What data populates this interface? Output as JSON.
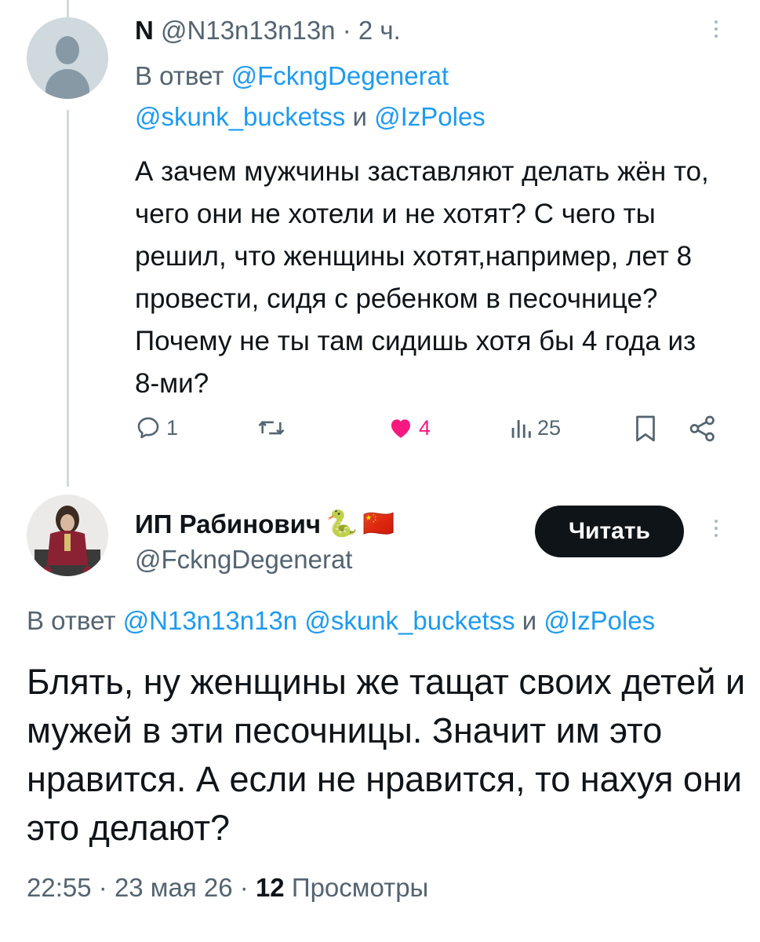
{
  "tweet1": {
    "author_name": "N",
    "handle": "@N13n13n13n",
    "separator": "·",
    "time": "2 ч.",
    "reply_prefix": "В ответ",
    "reply_mention_1": "@FckngDegenerat",
    "reply_mention_2": "@skunk_bucketss",
    "reply_and": "и",
    "reply_mention_3": "@IzPoles",
    "text": "А зачем мужчины заставляют делать жён то, чего они не хотели и не хотят? С чего ты решил, что женщины хотят,например, лет 8 провести, сидя с ребенком в песочнице? Почему не ты там сидишь хотя бы 4 года из 8-ми?",
    "actions": {
      "reply_count": "1",
      "repost_count": "",
      "like_count": "4",
      "views_count": "25"
    }
  },
  "tweet2": {
    "author_name": "ИП Рабинович",
    "emoji_snake": "🐍",
    "emoji_flag": "🇨🇳",
    "handle": "@FckngDegenerat",
    "follow_label": "Читать",
    "reply_prefix": "В ответ",
    "reply_mention_1": "@N13n13n13n",
    "reply_mention_2": "@skunk_bucketss",
    "reply_and": "и",
    "reply_mention_3": "@IzPoles",
    "text": "Блять, ну женщины же тащат своих детей и мужей в эти песочницы. Значит им это нравится. А если не нравится, то нахуя они это делают?",
    "time": "22:55",
    "date": "23 мая 26",
    "separator": "·",
    "views_count": "12",
    "views_label": "Просмотры"
  },
  "colors": {
    "accent": "#1d9bf0",
    "like": "#f91880",
    "muted": "#536471",
    "text": "#0f1419"
  }
}
